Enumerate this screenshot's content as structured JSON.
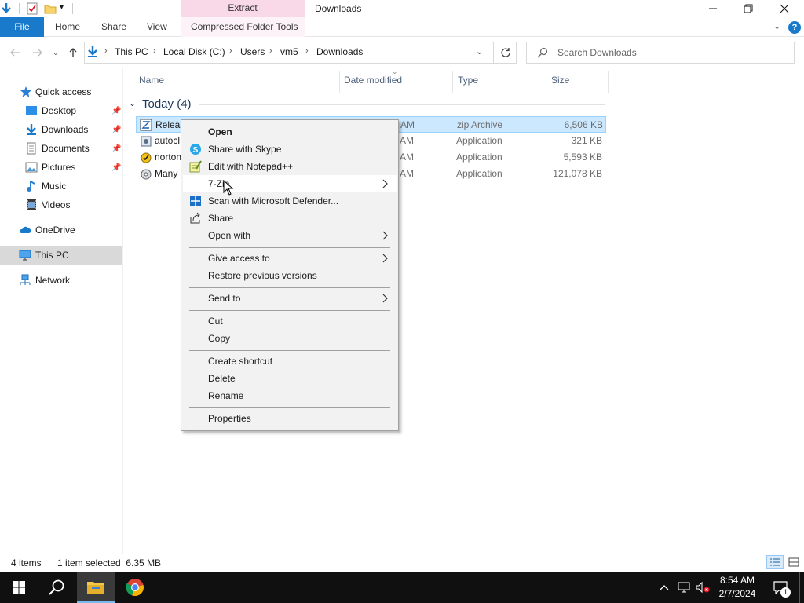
{
  "window": {
    "title": "Downloads",
    "contextual_tab_group": "Extract"
  },
  "ribbon": {
    "file": "File",
    "home": "Home",
    "share": "Share",
    "view": "View",
    "compressed_tools": "Compressed Folder Tools"
  },
  "address": {
    "crumbs": [
      "This PC",
      "Local Disk (C:)",
      "Users",
      "vm5",
      "Downloads"
    ],
    "search_placeholder": "Search Downloads"
  },
  "nav": {
    "quick_access": "Quick access",
    "items": [
      {
        "label": "Desktop",
        "pinned": true
      },
      {
        "label": "Downloads",
        "pinned": true
      },
      {
        "label": "Documents",
        "pinned": true
      },
      {
        "label": "Pictures",
        "pinned": true
      },
      {
        "label": "Music",
        "pinned": false
      },
      {
        "label": "Videos",
        "pinned": false
      }
    ],
    "onedrive": "OneDrive",
    "this_pc": "This PC",
    "network": "Network"
  },
  "columns": {
    "name": "Name",
    "date_modified": "Date modified",
    "type": "Type",
    "size": "Size"
  },
  "group": {
    "title": "Today (4)"
  },
  "files": [
    {
      "name": "Releas",
      "date": "AM",
      "type": "zip Archive",
      "size": "6,506 KB",
      "selected": true
    },
    {
      "name": "autocl",
      "date": "AM",
      "type": "Application",
      "size": "321 KB",
      "selected": false
    },
    {
      "name": "norton",
      "date": "AM",
      "type": "Application",
      "size": "5,593 KB",
      "selected": false
    },
    {
      "name": "Many",
      "date": "AM",
      "type": "Application",
      "size": "121,078 KB",
      "selected": false
    }
  ],
  "context_menu": {
    "open": "Open",
    "share_skype": "Share with Skype",
    "edit_notepad": "Edit with Notepad++",
    "seven_zip": "7-Zip",
    "scan_defender": "Scan with Microsoft Defender...",
    "share": "Share",
    "open_with": "Open with",
    "give_access": "Give access to",
    "restore_versions": "Restore previous versions",
    "send_to": "Send to",
    "cut": "Cut",
    "copy": "Copy",
    "create_shortcut": "Create shortcut",
    "delete": "Delete",
    "rename": "Rename",
    "properties": "Properties"
  },
  "status": {
    "items": "4 items",
    "selection": "1 item selected  6.35 MB"
  },
  "clock": {
    "time": "8:54 AM",
    "date": "2/7/2024"
  },
  "notifications": {
    "count": "1"
  },
  "colors": {
    "accent": "#1979ca",
    "selection": "#cce8ff",
    "contextual_tab": "#f9d9e8",
    "taskbar": "#101010"
  }
}
